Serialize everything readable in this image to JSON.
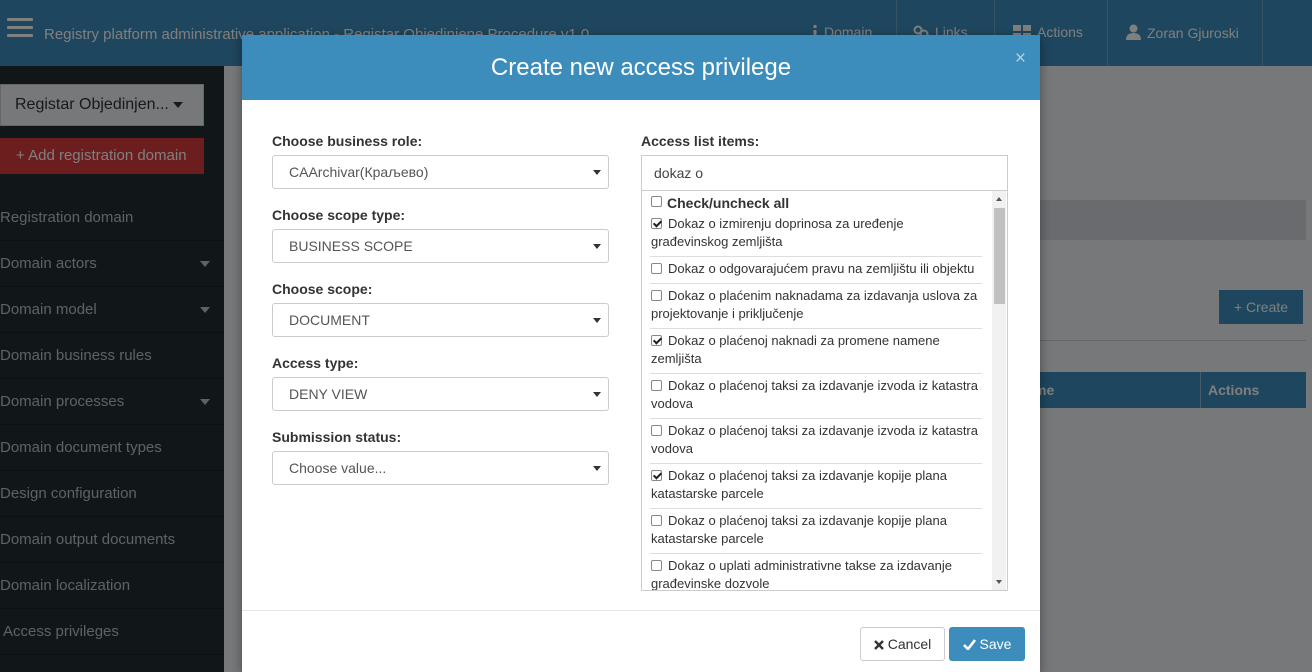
{
  "navbar": {
    "app_title": "Registry platform administrative application - Registar Objedinjene Procedure v1.0",
    "domain_label": "Domain",
    "links_label": "Links",
    "actions_label": "Actions",
    "user_name": "Zoran Gjuroski"
  },
  "sidebar": {
    "scope_selector": "Registar Objedinjen...",
    "add_domain_label": "Add registration domain",
    "items": [
      {
        "label": "Registration domain"
      },
      {
        "label": "Domain actors"
      },
      {
        "label": "Domain model"
      },
      {
        "label": "Domain business rules"
      },
      {
        "label": "Domain processes"
      },
      {
        "label": "Domain document types"
      },
      {
        "label": "Design configuration"
      },
      {
        "label": "Domain output documents"
      },
      {
        "label": "Domain localization"
      },
      {
        "label": "Access privileges"
      }
    ]
  },
  "background": {
    "create_label": "Create",
    "col_name_fragment": "me",
    "col_actions": "Actions"
  },
  "modal": {
    "title": "Create new access privilege",
    "close_symbol": "×",
    "business_role_label": "Choose business role:",
    "business_role_value": "CAArchivar(Краљево)",
    "scope_type_label": "Choose scope type:",
    "scope_type_value": "BUSINESS SCOPE",
    "scope_label": "Choose scope:",
    "scope_value": "DOCUMENT",
    "access_type_label": "Access type:",
    "access_type_value": "DENY VIEW",
    "submission_status_label": "Submission status:",
    "submission_status_value": "Choose value...",
    "acl_label": "Access list items:",
    "acl_search_value": "dokaz o",
    "check_all_label": "Check/uncheck all",
    "items": [
      {
        "text": "Dokaz o izmirenju doprinosa za uređenje građevinskog zemljišta",
        "checked": true
      },
      {
        "text": "Dokaz o odgovarajućem pravu na zemljištu ili objektu",
        "checked": false
      },
      {
        "text": "Dokaz o plaćenim naknadama za izdavanja uslova za projektovanje i priključenje",
        "checked": false
      },
      {
        "text": "Dokaz o plaćenoj naknadi za promene namene zemljišta",
        "checked": true
      },
      {
        "text": "Dokaz o plaćenoj taksi za izdavanje izvoda iz katastra vodova",
        "checked": false
      },
      {
        "text": "Dokaz o plaćenoj taksi za izdavanje izvoda iz katastra vodova",
        "checked": false
      },
      {
        "text": "Dokaz o plaćenoj taksi za izdavanje kopije plana katastarske parcele",
        "checked": true
      },
      {
        "text": "Dokaz o plaćenoj taksi za izdavanje kopije plana katastarske parcele",
        "checked": false
      },
      {
        "text": "Dokaz o uplati administrativne takse za izdavanje građevinske dozvole",
        "checked": false
      }
    ],
    "cancel_label": "Cancel",
    "save_label": "Save"
  }
}
